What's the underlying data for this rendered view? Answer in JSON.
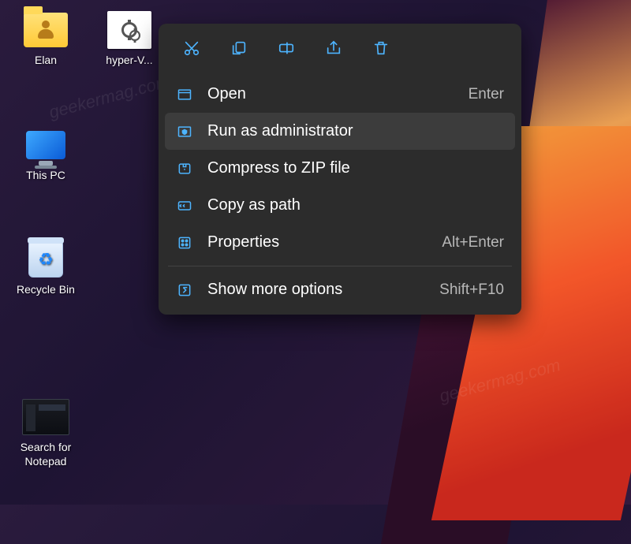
{
  "desktop": {
    "icons": [
      {
        "label": "Elan"
      },
      {
        "label": "hyper-V..."
      },
      {
        "label": "This PC"
      },
      {
        "label": "Recycle Bin"
      },
      {
        "label": "Search for\nNotepad"
      }
    ]
  },
  "contextMenu": {
    "quickActions": [
      {
        "name": "cut"
      },
      {
        "name": "copy"
      },
      {
        "name": "rename"
      },
      {
        "name": "share"
      },
      {
        "name": "delete"
      }
    ],
    "items": [
      {
        "icon": "open",
        "label": "Open",
        "accel": "Enter"
      },
      {
        "icon": "admin",
        "label": "Run as administrator",
        "accel": "",
        "hover": true
      },
      {
        "icon": "zip",
        "label": "Compress to ZIP file",
        "accel": ""
      },
      {
        "icon": "copypath",
        "label": "Copy as path",
        "accel": ""
      },
      {
        "icon": "properties",
        "label": "Properties",
        "accel": "Alt+Enter"
      }
    ],
    "moreOptions": {
      "label": "Show more options",
      "accel": "Shift+F10"
    }
  },
  "watermark": "geekermag.com"
}
